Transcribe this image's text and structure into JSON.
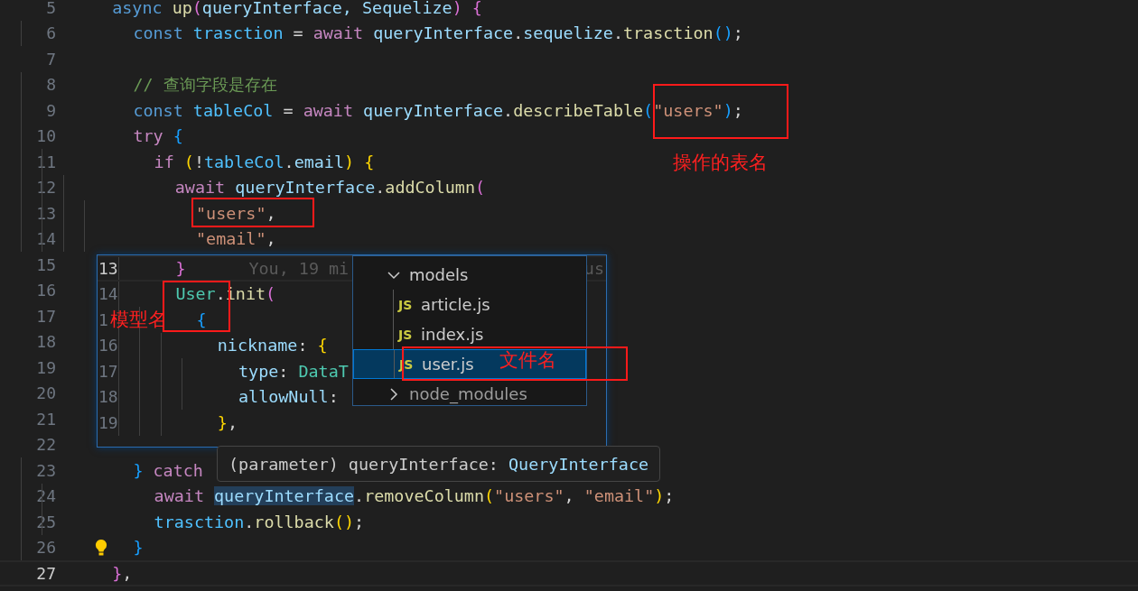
{
  "editor": {
    "lines": [
      {
        "number": "5",
        "current": false,
        "tokens": [
          {
            "t": "  async ",
            "kind": "storage"
          },
          {
            "t": "up",
            "kind": "function"
          },
          {
            "t": "(",
            "kind": "bracket2"
          },
          {
            "t": "queryInterface, Sequelize",
            "kind": "variable"
          },
          {
            "t": ")",
            "kind": "bracket2"
          },
          {
            "t": " {",
            "kind": "bracket2"
          }
        ]
      },
      {
        "number": "6",
        "current": false,
        "tokens": [
          {
            "t": "    const ",
            "kind": "storage"
          },
          {
            "t": "trasction",
            "kind": "constant"
          },
          {
            "t": " = ",
            "kind": "punctuation"
          },
          {
            "t": "await ",
            "kind": "keyword"
          },
          {
            "t": "queryInterface",
            "kind": "variable"
          },
          {
            "t": ".",
            "kind": "punctuation"
          },
          {
            "t": "sequelize",
            "kind": "variable"
          },
          {
            "t": ".",
            "kind": "punctuation"
          },
          {
            "t": "trasction",
            "kind": "function"
          },
          {
            "t": "()",
            "kind": "bracket3"
          },
          {
            "t": ";",
            "kind": "punctuation"
          }
        ]
      },
      {
        "number": "7",
        "current": false
      },
      {
        "number": "8",
        "current": false,
        "tokens": [
          {
            "t": "    // 查询字段是存在",
            "kind": "comment"
          }
        ]
      },
      {
        "number": "9",
        "current": false,
        "tokens": [
          {
            "t": "    const ",
            "kind": "storage"
          },
          {
            "t": "tableCol",
            "kind": "constant"
          },
          {
            "t": " = ",
            "kind": "punctuation"
          },
          {
            "t": "await ",
            "kind": "keyword"
          },
          {
            "t": "queryInterface",
            "kind": "variable"
          },
          {
            "t": ".",
            "kind": "punctuation"
          },
          {
            "t": "describeTable",
            "kind": "function"
          },
          {
            "t": "(",
            "kind": "bracket3"
          },
          {
            "t": "\"users\"",
            "kind": "string"
          },
          {
            "t": ")",
            "kind": "bracket3"
          },
          {
            "t": ";",
            "kind": "punctuation"
          }
        ]
      },
      {
        "number": "10",
        "current": false,
        "tokens": [
          {
            "t": "    try ",
            "kind": "keyword"
          },
          {
            "t": "{",
            "kind": "bracket3"
          }
        ]
      },
      {
        "number": "11",
        "current": false,
        "tokens": [
          {
            "t": "      if ",
            "kind": "keyword"
          },
          {
            "t": "(",
            "kind": "bracket1"
          },
          {
            "t": "!",
            "kind": "punctuation"
          },
          {
            "t": "tableCol",
            "kind": "constant"
          },
          {
            "t": ".",
            "kind": "punctuation"
          },
          {
            "t": "email",
            "kind": "variable"
          },
          {
            "t": ")",
            "kind": "bracket1"
          },
          {
            "t": " {",
            "kind": "bracket1"
          }
        ]
      },
      {
        "number": "12",
        "current": false,
        "tokens": [
          {
            "t": "        await ",
            "kind": "keyword"
          },
          {
            "t": "queryInterface",
            "kind": "variable"
          },
          {
            "t": ".",
            "kind": "punctuation"
          },
          {
            "t": "addColumn",
            "kind": "function"
          },
          {
            "t": "(",
            "kind": "bracket2"
          }
        ]
      },
      {
        "number": "13",
        "current": false,
        "tokens": [
          {
            "t": "          \"users\"",
            "kind": "string"
          },
          {
            "t": ",",
            "kind": "punctuation"
          }
        ]
      },
      {
        "number": "14",
        "current": false,
        "tokens": [
          {
            "t": "          \"email\"",
            "kind": "string"
          },
          {
            "t": ",",
            "kind": "punctuation"
          }
        ]
      },
      {
        "number": "15",
        "current": false
      },
      {
        "number": "16",
        "current": false
      },
      {
        "number": "17",
        "current": false
      },
      {
        "number": "18",
        "current": false
      },
      {
        "number": "19",
        "current": false
      },
      {
        "number": "20",
        "current": false
      },
      {
        "number": "21",
        "current": false
      },
      {
        "number": "22",
        "current": false
      },
      {
        "number": "23",
        "current": false,
        "tokens": [
          {
            "t": "    }",
            "kind": "bracket3"
          },
          {
            "t": " catch",
            "kind": "keyword"
          }
        ]
      },
      {
        "number": "24",
        "current": false,
        "tokens": [
          {
            "t": "      await ",
            "kind": "keyword"
          },
          {
            "t": "queryInterface",
            "kind": "highlighted"
          },
          {
            "t": ".",
            "kind": "punctuation"
          },
          {
            "t": "removeColumn",
            "kind": "function"
          },
          {
            "t": "(",
            "kind": "bracket1"
          },
          {
            "t": "\"users\"",
            "kind": "string"
          },
          {
            "t": ", ",
            "kind": "punctuation"
          },
          {
            "t": "\"email\"",
            "kind": "string"
          },
          {
            "t": ")",
            "kind": "bracket1"
          },
          {
            "t": ";",
            "kind": "punctuation"
          }
        ]
      },
      {
        "number": "25",
        "current": false,
        "tokens": [
          {
            "t": "      trasction",
            "kind": "constant"
          },
          {
            "t": ".",
            "kind": "punctuation"
          },
          {
            "t": "rollback",
            "kind": "function"
          },
          {
            "t": "()",
            "kind": "bracket1"
          },
          {
            "t": ";",
            "kind": "punctuation"
          }
        ]
      },
      {
        "number": "26",
        "current": false,
        "lightbulb": true,
        "tokens": [
          {
            "t": "    }",
            "kind": "bracket3"
          }
        ]
      },
      {
        "number": "27",
        "current": true,
        "tokens": [
          {
            "t": "  }",
            "kind": "bracket2"
          },
          {
            "t": ",",
            "kind": "punctuation"
          }
        ]
      }
    ]
  },
  "peek": {
    "blame_left": "You, 19 mi",
    "blame_right": "us",
    "lines": [
      {
        "number": "13",
        "current": true,
        "tokens": [
          {
            "t": "    }",
            "kind": "bracket2"
          }
        ]
      },
      {
        "number": "14",
        "current": false,
        "tokens": [
          {
            "t": "    User",
            "kind": "class"
          },
          {
            "t": ".",
            "kind": "punctuation"
          },
          {
            "t": "init",
            "kind": "function"
          },
          {
            "t": "(",
            "kind": "bracket2"
          }
        ]
      },
      {
        "number": "1",
        "current": false,
        "tokens": [
          {
            "t": "      {",
            "kind": "bracket3"
          }
        ]
      },
      {
        "number": "16",
        "current": false,
        "tokens": [
          {
            "t": "        nickname",
            "kind": "variable"
          },
          {
            "t": ": ",
            "kind": "punctuation"
          },
          {
            "t": "{",
            "kind": "bracket1"
          }
        ]
      },
      {
        "number": "17",
        "current": false,
        "tokens": [
          {
            "t": "          type",
            "kind": "variable"
          },
          {
            "t": ": ",
            "kind": "punctuation"
          },
          {
            "t": "DataT",
            "kind": "class"
          }
        ]
      },
      {
        "number": "18",
        "current": false,
        "tokens": [
          {
            "t": "          allowNull",
            "kind": "variable"
          },
          {
            "t": ":",
            "kind": "punctuation"
          }
        ]
      },
      {
        "number": "19",
        "current": false,
        "tokens": [
          {
            "t": "        }",
            "kind": "bracket1"
          },
          {
            "t": ",",
            "kind": "punctuation"
          }
        ]
      }
    ]
  },
  "file_tree": {
    "items": [
      {
        "kind": "folder",
        "label": "models",
        "expanded": true,
        "selected": false,
        "children": [
          {
            "kind": "file",
            "badge": "JS",
            "label": "article.js",
            "selected": false
          },
          {
            "kind": "file",
            "badge": "JS",
            "label": "index.js",
            "selected": false
          },
          {
            "kind": "file",
            "badge": "JS",
            "label": "user.js",
            "selected": true
          }
        ]
      },
      {
        "kind": "folder",
        "label": "node_modules",
        "expanded": false,
        "selected": false
      }
    ]
  },
  "tooltip": {
    "tokens": [
      {
        "t": "(parameter) queryInterface: ",
        "kind": "plain"
      },
      {
        "t": "QueryInterface",
        "kind": "type"
      }
    ]
  },
  "annotations": [
    {
      "text": "操作的表名"
    },
    {
      "text": "模型名"
    },
    {
      "text": "文件名"
    }
  ]
}
